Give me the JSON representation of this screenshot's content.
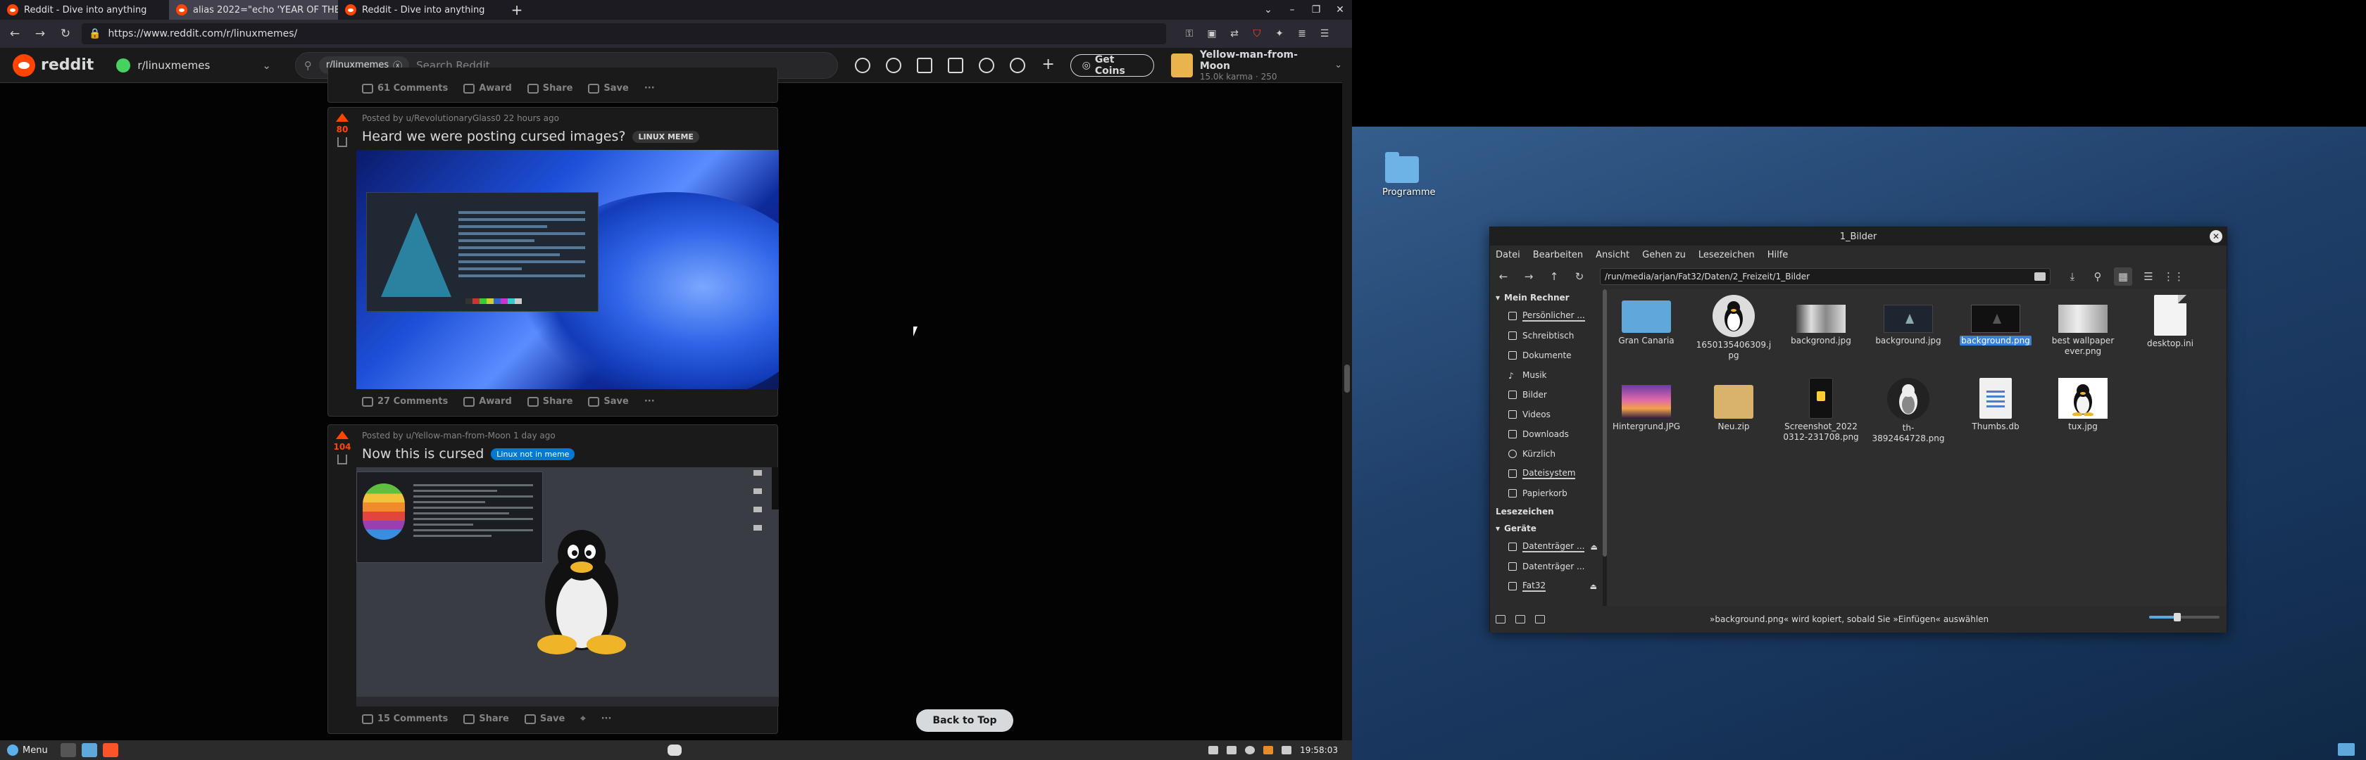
{
  "browser": {
    "tabs": [
      {
        "label": "Reddit - Dive into anything",
        "active": false
      },
      {
        "label": "alias 2022=\"echo 'YEAR OF THE",
        "active": true
      },
      {
        "label": "Reddit - Dive into anything",
        "active": false
      }
    ],
    "new_tab": "+",
    "url": "https://www.reddit.com/r/linuxmemes/"
  },
  "reddit": {
    "logo_text": "reddit",
    "subreddit": "r/linuxmemes",
    "search_scope": "r/linuxmemes",
    "search_placeholder": "Search Reddit",
    "get_coins": "Get Coins",
    "username": "Yellow-man-from-Moon",
    "karma": "15.0k karma",
    "coins": "250"
  },
  "feed": {
    "top_actions": {
      "comments": "61 Comments",
      "award": "Award",
      "share": "Share",
      "save": "Save"
    },
    "posts": [
      {
        "score": "80",
        "meta": "Posted by u/RevolutionaryGlass0 22 hours ago",
        "title": "Heard we were posting cursed images?",
        "flair": "LINUX MEME",
        "comments": "27 Comments",
        "award": "Award",
        "share": "Share",
        "save": "Save"
      },
      {
        "score": "104",
        "meta": "Posted by u/Yellow-man-from-Moon 1 day ago",
        "title": "Now this is cursed",
        "flair": "Linux not in meme",
        "comments": "15 Comments",
        "share": "Share",
        "save": "Save"
      }
    ],
    "back_to_top": "Back to Top"
  },
  "taskbar_left": {
    "menu_label": "Menu",
    "clock": "19:58:03"
  },
  "desktop": {
    "icon_label": "Programme"
  },
  "file_manager": {
    "title": "1_Bilder",
    "menu": [
      "Datei",
      "Bearbeiten",
      "Ansicht",
      "Gehen zu",
      "Lesezeichen",
      "Hilfe"
    ],
    "path": "/run/media/arjan/Fat32/Daten/2_Freizeit/1_Bilder",
    "sidebar": {
      "section_computer": "Mein Rechner",
      "items": [
        "Persönlicher ...",
        "Schreibtisch",
        "Dokumente",
        "Musik",
        "Bilder",
        "Videos",
        "Downloads",
        "Kürzlich",
        "Dateisystem",
        "Papierkorb"
      ],
      "section_bookmarks": "Lesezeichen",
      "section_devices": "Geräte",
      "devices": [
        "Datenträger ...",
        "Datenträger ...",
        "Fat32"
      ]
    },
    "files": [
      {
        "name": "Gran Canaria",
        "kind": "folder",
        "selected": false
      },
      {
        "name": "1650135406309.jpg",
        "kind": "tux-round",
        "selected": false
      },
      {
        "name": "backgrond.jpg",
        "kind": "img-mix",
        "selected": false
      },
      {
        "name": "background.jpg",
        "kind": "img-dark",
        "selected": false
      },
      {
        "name": "background.png",
        "kind": "img-black",
        "selected": true
      },
      {
        "name": "best wallpaper ever.png",
        "kind": "img-light",
        "selected": false
      },
      {
        "name": "desktop.ini",
        "kind": "doc",
        "selected": false
      },
      {
        "name": "Hintergrund.JPG",
        "kind": "sunset",
        "selected": false
      },
      {
        "name": "Neu.zip",
        "kind": "zip",
        "selected": false
      },
      {
        "name": "Screenshot_20220312-231708.png",
        "kind": "phone",
        "selected": false
      },
      {
        "name": "th-3892464728.png",
        "kind": "tux-dark",
        "selected": false
      },
      {
        "name": "Thumbs.db",
        "kind": "db",
        "selected": false
      },
      {
        "name": "tux.jpg",
        "kind": "tux",
        "selected": false
      }
    ],
    "status": "»background.png« wird kopiert, sobald Sie »Einfügen« auswählen",
    "zoom_fraction": 0.4
  }
}
